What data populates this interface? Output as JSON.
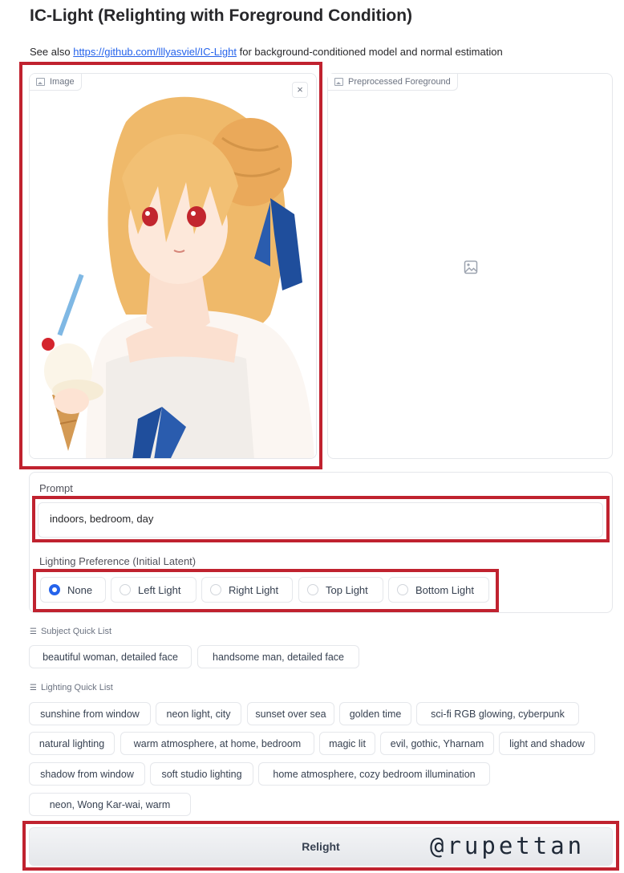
{
  "header": {
    "title": "IC-Light (Relighting with Foreground Condition)",
    "see_also_prefix": "See also",
    "see_also_link": "https://github.com/lllyasviel/IC-Light",
    "see_also_suffix": "for background-conditioned model and normal estimation"
  },
  "image_panel": {
    "label": "Image",
    "icon": "image-icon",
    "close_icon": "×"
  },
  "preprocessed_panel": {
    "label": "Preprocessed Foreground",
    "icon": "image-icon"
  },
  "prompt": {
    "label": "Prompt",
    "value": "indoors, bedroom, day"
  },
  "lighting": {
    "label": "Lighting Preference (Initial Latent)",
    "options": [
      "None",
      "Left Light",
      "Right Light",
      "Top Light",
      "Bottom Light"
    ],
    "selected": "None"
  },
  "subject_quick_list": {
    "label": "Subject Quick List",
    "items": [
      "beautiful woman, detailed face",
      "handsome man, detailed face"
    ]
  },
  "lighting_quick_list": {
    "label": "Lighting Quick List",
    "items": [
      "sunshine from window",
      "neon light, city",
      "sunset over sea",
      "golden time",
      "sci-fi RGB glowing, cyberpunk",
      "natural lighting",
      "warm atmosphere, at home, bedroom",
      "magic lit",
      "evil, gothic, Yharnam",
      "light and shadow",
      "shadow from window",
      "soft studio lighting",
      "home atmosphere, cozy bedroom illumination",
      "neon, Wong Kar-wai, warm"
    ]
  },
  "relight_button": "Relight",
  "watermark": "@rupettan",
  "colors": {
    "accent": "#2563eb",
    "highlight_box": "#c0222f",
    "border": "#e5e7eb"
  }
}
